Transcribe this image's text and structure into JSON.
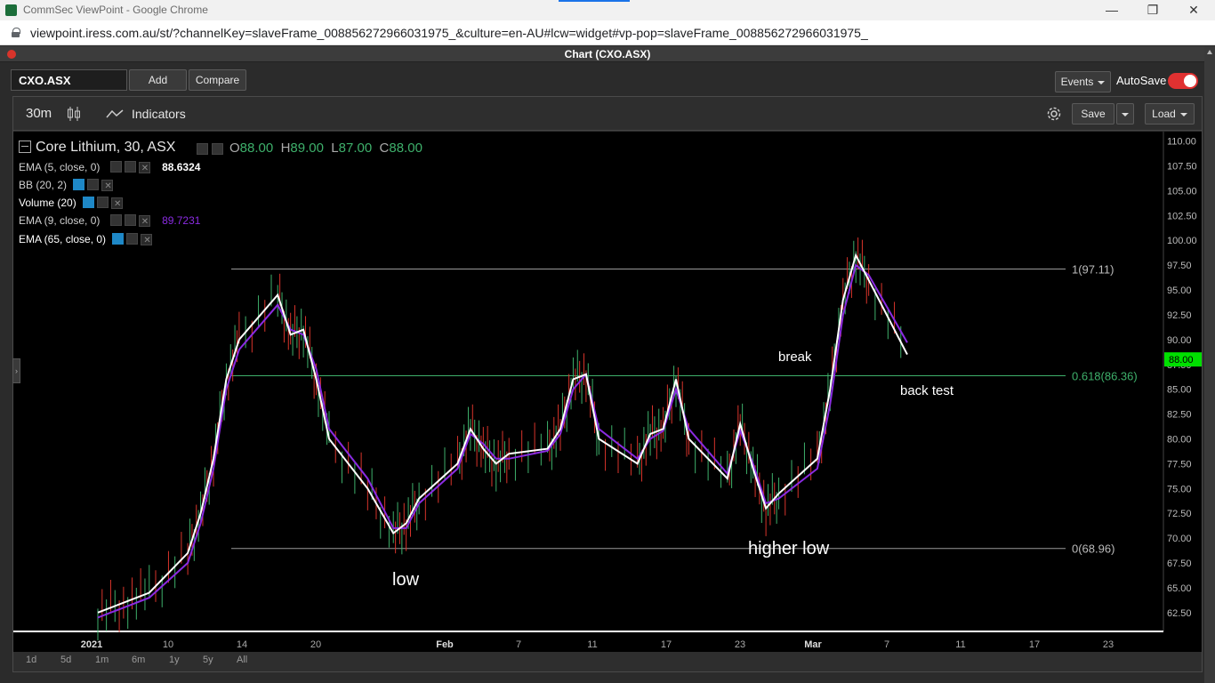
{
  "browser": {
    "tab_title": "CommSec ViewPoint - Google Chrome",
    "url": "viewpoint.iress.com.au/st/?channelKey=slaveFrame_008856272966031975_&culture=en-AU#lcw=widget#vp-pop=slaveFrame_008856272966031975_",
    "minimize": "—",
    "restore": "❐",
    "close": "✕"
  },
  "panel": {
    "title": "Chart (CXO.ASX)"
  },
  "toolbar": {
    "symbol": "CXO.ASX",
    "add_label": "Add",
    "compare_label": "Compare",
    "events_label": "Events",
    "autosave_label": "AutoSave",
    "interval": "30m",
    "indicators_label": "Indicators",
    "save_label": "Save",
    "load_label": "Load"
  },
  "legend": {
    "instrument": "Core Lithium, 30, ASX",
    "ohlc": {
      "o_label": "O",
      "o": "88.00",
      "h_label": "H",
      "h": "89.00",
      "l_label": "L",
      "l": "87.00",
      "c_label": "C",
      "c": "88.00"
    },
    "studies": [
      {
        "name": "EMA (5, close, 0)",
        "value": "88.6324",
        "value_color": "#ffffff"
      },
      {
        "name": "BB (20, 2)",
        "value": ""
      },
      {
        "name": "Volume (20)",
        "value": ""
      },
      {
        "name": "EMA (9, close, 0)",
        "value": "89.7231",
        "value_color": "#8a2be2"
      },
      {
        "name": "EMA (65, close, 0)",
        "value": ""
      }
    ]
  },
  "annotations": {
    "break": "break",
    "back_test": "back test",
    "low": "low",
    "higher_low": "higher low",
    "fib_1": "1(97.11)",
    "fib_0618": "0.618(86.36)",
    "fib_0": "0(68.96)",
    "last_price": "88.00"
  },
  "range_buttons": [
    "1d",
    "5d",
    "1m",
    "6m",
    "1y",
    "5y",
    "All"
  ],
  "chart_data": {
    "type": "line",
    "title": "Core Lithium, 30, ASX",
    "ylim": [
      61.5,
      110.5
    ],
    "y_ticks": [
      "110.00",
      "107.50",
      "105.00",
      "102.50",
      "100.00",
      "97.50",
      "95.00",
      "92.50",
      "90.00",
      "87.50",
      "85.00",
      "82.50",
      "80.00",
      "77.50",
      "75.00",
      "72.50",
      "70.00",
      "67.50",
      "65.00",
      "62.50"
    ],
    "x_ticks": [
      "2021",
      "10",
      "14",
      "20",
      "Feb",
      "7",
      "11",
      "17",
      "23",
      "Mar",
      "7",
      "11",
      "17",
      "23"
    ],
    "fib_levels": [
      {
        "label": "1(97.11)",
        "value": 97.11
      },
      {
        "label": "0.618(86.36)",
        "value": 86.36
      },
      {
        "label": "0(68.96)",
        "value": 68.96
      }
    ],
    "last_price": 88.0,
    "series": [
      {
        "name": "EMA (5, close, 0)",
        "color": "#ffffff",
        "x": [
          "2021-01-04",
          "2021-01-06",
          "2021-01-08",
          "2021-01-11",
          "2021-01-12",
          "2021-01-13",
          "2021-01-14",
          "2021-01-15",
          "2021-01-18",
          "2021-01-19",
          "2021-01-20",
          "2021-01-21",
          "2021-01-22",
          "2021-01-25",
          "2021-01-27",
          "2021-01-28",
          "2021-01-29",
          "2021-02-01",
          "2021-02-02",
          "2021-02-03",
          "2021-02-04",
          "2021-02-05",
          "2021-02-08",
          "2021-02-09",
          "2021-02-10",
          "2021-02-11",
          "2021-02-12",
          "2021-02-15",
          "2021-02-16",
          "2021-02-17",
          "2021-02-18",
          "2021-02-19",
          "2021-02-22",
          "2021-02-23",
          "2021-02-24",
          "2021-02-25",
          "2021-02-26",
          "2021-03-01",
          "2021-03-02",
          "2021-03-03",
          "2021-03-04",
          "2021-03-05",
          "2021-03-08"
        ],
        "y": [
          62.5,
          63.5,
          64.5,
          68.5,
          72.5,
          78.0,
          86.0,
          90.0,
          94.5,
          90.5,
          91.0,
          86.0,
          80.0,
          75.0,
          70.5,
          71.5,
          74.0,
          77.5,
          81.0,
          79.0,
          77.5,
          78.5,
          79.0,
          81.0,
          86.0,
          86.5,
          80.0,
          77.5,
          80.5,
          81.0,
          86.0,
          80.0,
          76.0,
          81.5,
          77.0,
          73.0,
          74.5,
          78.0,
          85.0,
          94.0,
          98.5,
          96.0,
          88.5
        ]
      },
      {
        "name": "EMA (9, close, 0)",
        "color": "#8a2be2",
        "x": [
          "2021-01-04",
          "2021-01-06",
          "2021-01-08",
          "2021-01-11",
          "2021-01-12",
          "2021-01-13",
          "2021-01-14",
          "2021-01-15",
          "2021-01-18",
          "2021-01-19",
          "2021-01-20",
          "2021-01-21",
          "2021-01-22",
          "2021-01-25",
          "2021-01-27",
          "2021-01-28",
          "2021-01-29",
          "2021-02-01",
          "2021-02-02",
          "2021-02-03",
          "2021-02-04",
          "2021-02-05",
          "2021-02-08",
          "2021-02-09",
          "2021-02-10",
          "2021-02-11",
          "2021-02-12",
          "2021-02-15",
          "2021-02-16",
          "2021-02-17",
          "2021-02-18",
          "2021-02-19",
          "2021-02-22",
          "2021-02-23",
          "2021-02-24",
          "2021-02-25",
          "2021-02-26",
          "2021-03-01",
          "2021-03-02",
          "2021-03-03",
          "2021-03-04",
          "2021-03-05",
          "2021-03-08"
        ],
        "y": [
          62.0,
          63.0,
          64.0,
          67.5,
          71.5,
          77.0,
          85.0,
          89.0,
          93.5,
          91.0,
          90.5,
          87.0,
          81.0,
          76.0,
          71.0,
          71.0,
          73.5,
          77.0,
          80.5,
          79.5,
          78.0,
          78.0,
          78.8,
          80.5,
          85.0,
          86.5,
          81.0,
          78.0,
          80.0,
          80.8,
          85.0,
          81.0,
          76.5,
          80.8,
          77.5,
          73.5,
          74.0,
          77.0,
          83.5,
          92.5,
          97.5,
          96.5,
          89.7
        ]
      }
    ]
  }
}
